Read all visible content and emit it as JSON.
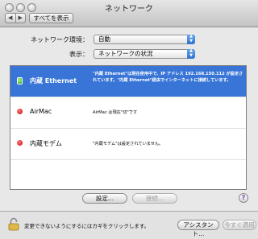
{
  "window": {
    "title": "ネットワーク"
  },
  "toolbar": {
    "back_label": "◀",
    "forward_label": "▶",
    "show_all_label": "すべてを表示"
  },
  "location": {
    "label": "ネットワーク環境：",
    "value": "自動"
  },
  "show": {
    "label": "表示：",
    "value": "ネットワークの状況"
  },
  "services": [
    {
      "name": "内蔵 Ethernet",
      "status": "green",
      "selected": true,
      "desc": "\"内蔵 Ethernet\"は現在使用中で、IP アドレス 192.168.150.112 が設定されています。\"内蔵 Ethernet\"経由でインターネットに接続しています。"
    },
    {
      "name": "AirMac",
      "status": "red",
      "selected": false,
      "desc": "AirMac は現在\"切\"です"
    },
    {
      "name": "内蔵モデム",
      "status": "red",
      "selected": false,
      "desc": "\"内蔵モデム\"は設定されていません。"
    }
  ],
  "buttons": {
    "configure": "設定...",
    "connect": "接続...",
    "help": "?",
    "assistant": "アシスタント...",
    "apply": "今すぐ適用"
  },
  "lock": {
    "text": "変更できないようにするにはカギをクリックします。"
  },
  "colors": {
    "selection": "#3875d7",
    "status_on": "#2a9a10",
    "status_off": "#c00000"
  }
}
